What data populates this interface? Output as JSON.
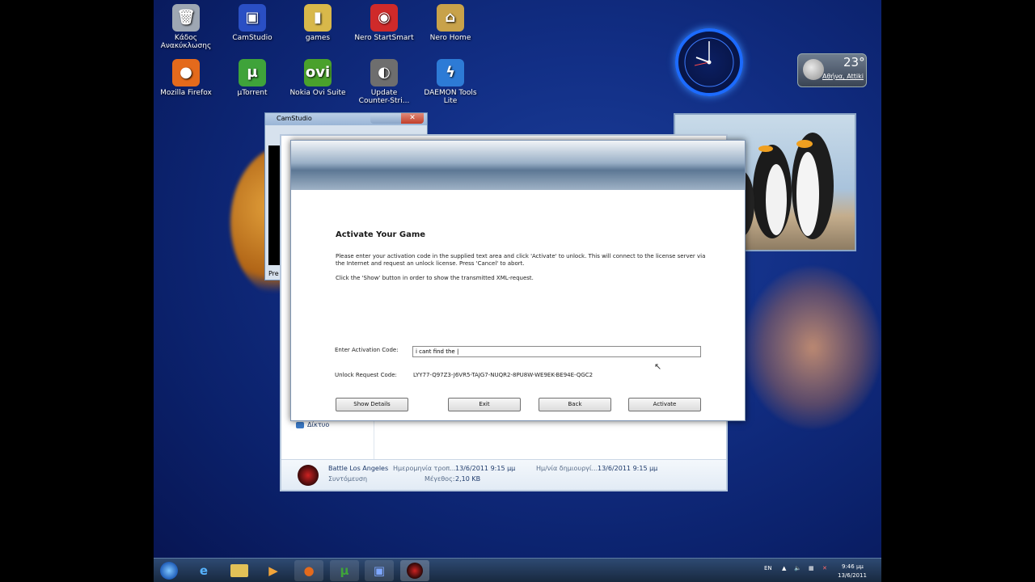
{
  "desktop": {
    "icons": [
      {
        "label": "Κάδος\nΑνακύκλωσης",
        "icon": "recycle-bin-icon",
        "color": "#9ea7b3",
        "glyph": "🗑"
      },
      {
        "label": "CamStudio",
        "icon": "camstudio-icon",
        "color": "#2a4fc4",
        "glyph": "▣"
      },
      {
        "label": "games",
        "icon": "folder-icon",
        "color": "#d8b84a",
        "glyph": "▮"
      },
      {
        "label": "Nero StartSmart",
        "icon": "nero-startsmart-icon",
        "color": "#cf2a2a",
        "glyph": "◉"
      },
      {
        "label": "Nero Home",
        "icon": "nero-home-icon",
        "color": "#c8a24a",
        "glyph": "⌂"
      },
      {
        "label": "Mozilla Firefox",
        "icon": "firefox-icon",
        "color": "#e46a1c",
        "glyph": "●"
      },
      {
        "label": "µTorrent",
        "icon": "utorrent-icon",
        "color": "#3fa33a",
        "glyph": "µ"
      },
      {
        "label": "Nokia Ovi Suite",
        "icon": "nokia-ovi-icon",
        "color": "#4aa12c",
        "glyph": "ovi"
      },
      {
        "label": "Update\nCounter-Stri...",
        "icon": "counter-strike-icon",
        "color": "#6e6e6e",
        "glyph": "◐"
      },
      {
        "label": "DAEMON Tools Lite",
        "icon": "daemon-tools-icon",
        "color": "#2d7bd6",
        "glyph": "ϟ"
      }
    ]
  },
  "gadgets": {
    "weather": {
      "temperature": "23°",
      "location": "Αθήνα, Attiki"
    }
  },
  "camstudio_window": {
    "title": "CamStudio",
    "status_text": "Pre"
  },
  "explorer_window": {
    "nav_item": "Δίκτυο",
    "file": {
      "name": "Battle Los Angeles",
      "type": "Συντόμευση",
      "modified_label": "Ημερομηνία τροπ...",
      "modified_value": "13/6/2011 9:15 μμ",
      "size_label": "Μέγεθος:",
      "size_value": "2,10 KB",
      "created_label": "Ημ/νία δημιουργί...",
      "created_value": "13/6/2011 9:15 μμ"
    }
  },
  "dialog": {
    "title": "Activate Your Game",
    "instructions_1": "Please enter your activation code in the supplied text area and click 'Activate' to unlock. This will connect to the license server via the Internet and request an unlock license. Press 'Cancel' to abort.",
    "instructions_2": "Click the 'Show' button in order to show the transmitted XML-request.",
    "activation_label": "Enter Activation Code:",
    "activation_value": "i cant find the |",
    "unlock_label": "Unlock Request Code:",
    "unlock_value": "LYY77-Q97Z3-J6VR5-TAJG7-NUQR2-8PU8W-WE9EK-BE94E-QGC2",
    "buttons": {
      "show_details": "Show Details",
      "exit": "Exit",
      "back": "Back",
      "activate": "Activate"
    }
  },
  "taskbar": {
    "language": "EN",
    "time": "9:46 μμ",
    "date": "13/6/2011"
  }
}
